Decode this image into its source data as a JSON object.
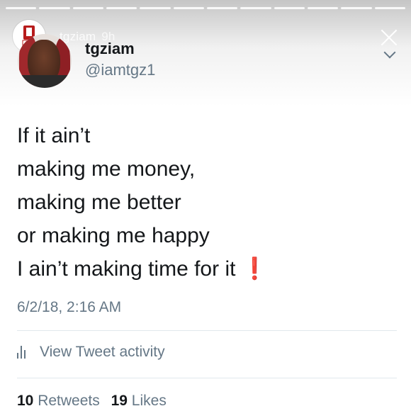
{
  "story": {
    "username": "tgziam",
    "age": "9h",
    "segments": 12
  },
  "tweet": {
    "display_name": "tgziam",
    "handle": "@iamtgz1",
    "lines": [
      "If it ain’t",
      "making me money,",
      "making me better",
      "or making me happy",
      "I ain’t making time for it"
    ],
    "emoji_name": "red-exclamation",
    "emoji": "❗",
    "timestamp": "6/2/18, 2:16 AM",
    "activity_label": "View Tweet activity",
    "retweets_count": "10",
    "retweets_label": "Retweets",
    "likes_count": "19",
    "likes_label": "Likes"
  },
  "colors": {
    "text": "#14171a",
    "secondary": "#657786",
    "divider": "#e1e8ed",
    "accent_red": "#e0161e"
  }
}
